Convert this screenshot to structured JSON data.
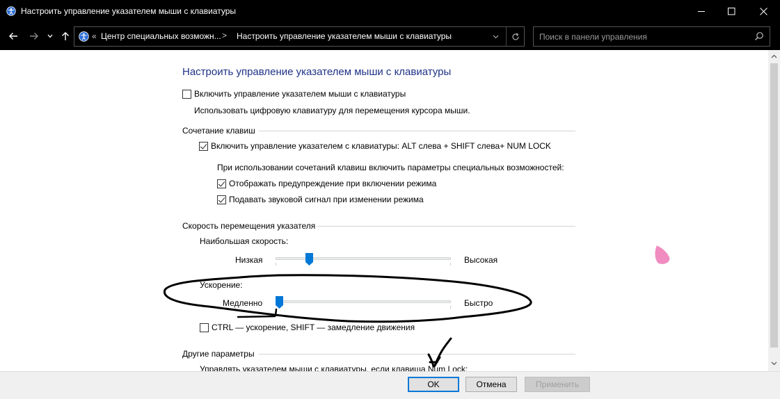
{
  "window": {
    "title": "Настроить управление указателем мыши с клавиатуры",
    "title_icon": "ease-of-access-icon"
  },
  "nav": {
    "breadcrumb_prefix": "«",
    "breadcrumb": [
      "Центр специальных возможн...",
      "Настроить управление указателем мыши с клавиатуры"
    ],
    "breadcrumb_separator": ">",
    "search_placeholder": "Поиск в панели управления"
  },
  "main": {
    "heading": "Настроить управление указателем мыши с клавиатуры",
    "enable_mouse_keys": {
      "label": "Включить управление указателем мыши с клавиатуры",
      "checked": false
    },
    "enable_description": "Использовать цифровую клавиатуру для перемещения курсора мыши.",
    "hotkey_section": {
      "title": "Сочетание клавиш",
      "hotkey_enable": {
        "label": "Включить управление указателем с клавиатуры: ALT слева + SHIFT слева+ NUM LOCK",
        "checked": true
      },
      "subtitle": "При использовании сочетаний клавиш включить параметры специальных возможностей:",
      "show_warning": {
        "label": "Отображать предупреждение при включении режима",
        "checked": true
      },
      "play_sound": {
        "label": "Подавать звуковой сигнал при изменении режима",
        "checked": true
      }
    },
    "speed_section": {
      "title": "Скорость перемещения указателя",
      "top_speed": {
        "label": "Наибольшая скорость:",
        "min_label": "Низкая",
        "max_label": "Высокая",
        "value": 0.18
      },
      "acceleration": {
        "label": "Ускорение:",
        "min_label": "Медленно",
        "max_label": "Быстро",
        "value": 0.0
      },
      "ctrl_shift": {
        "label": "CTRL — ускорение, SHIFT — замедление движения",
        "checked": false
      }
    },
    "other_section": {
      "title": "Другие параметры",
      "partial_line": "Управлять указателем мыши с клавиатуры, если клавиша Num Lock:"
    }
  },
  "footer": {
    "ok": "OK",
    "cancel": "Отмена",
    "apply": "Применить"
  },
  "colors": {
    "heading": "#1e3287",
    "slider_thumb": "#0078d7",
    "chrome": "#000000",
    "annotation_pink": "#f08cc0"
  }
}
